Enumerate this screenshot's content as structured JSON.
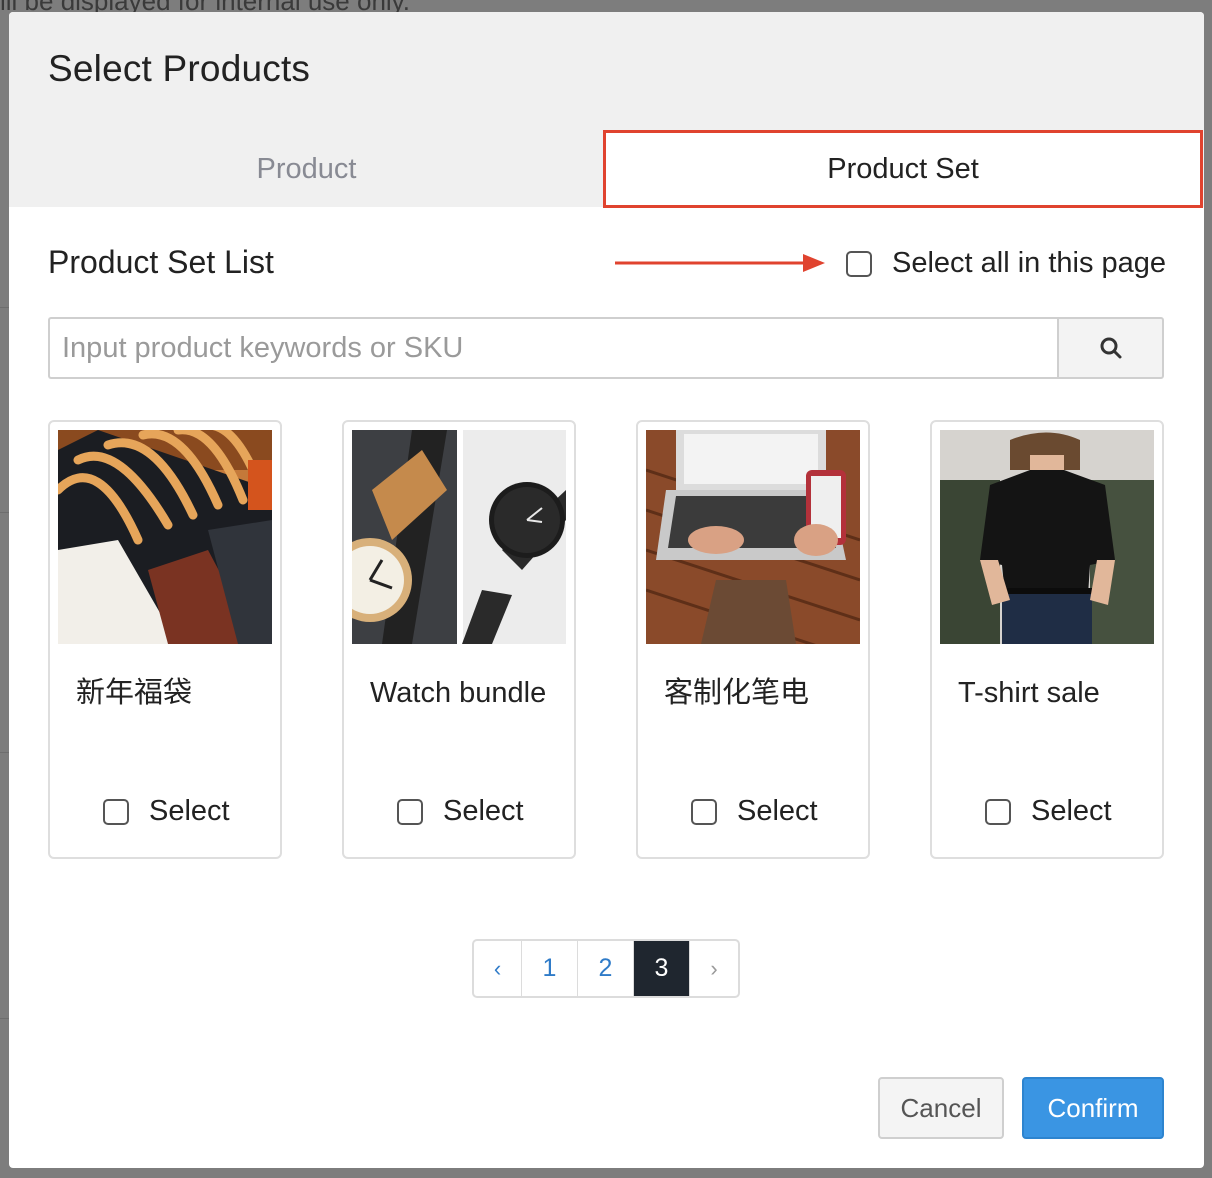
{
  "background": {
    "text": "ill be displayed for internal use only."
  },
  "modal": {
    "title": "Select Products",
    "tabs": [
      {
        "label": "Product",
        "active": false
      },
      {
        "label": "Product Set",
        "active": true
      }
    ],
    "section_title": "Product Set List",
    "select_all_label": "Select all in this page",
    "search": {
      "value": "",
      "placeholder": "Input product keywords or SKU"
    },
    "cards": [
      {
        "name": "新年福袋",
        "image": "clothes-on-hangers",
        "select_label": "Select",
        "checked": false
      },
      {
        "name": "Watch bundle",
        "image": "wooden-watches",
        "select_label": "Select",
        "checked": false
      },
      {
        "name": "客制化笔电",
        "image": "laptop-and-phone",
        "select_label": "Select",
        "checked": false
      },
      {
        "name": "T-shirt sale",
        "image": "black-t-shirt-model",
        "select_label": "Select",
        "checked": false
      }
    ],
    "pagination": {
      "prev": "‹",
      "pages": [
        "1",
        "2",
        "3"
      ],
      "current": "3",
      "next": "›"
    },
    "buttons": {
      "cancel": "Cancel",
      "confirm": "Confirm"
    }
  },
  "colors": {
    "highlight_border": "#e0432f",
    "arrow": "#e0432f",
    "primary": "#3a95e3",
    "active_page": "#1f262f",
    "link": "#2f7bc8"
  }
}
